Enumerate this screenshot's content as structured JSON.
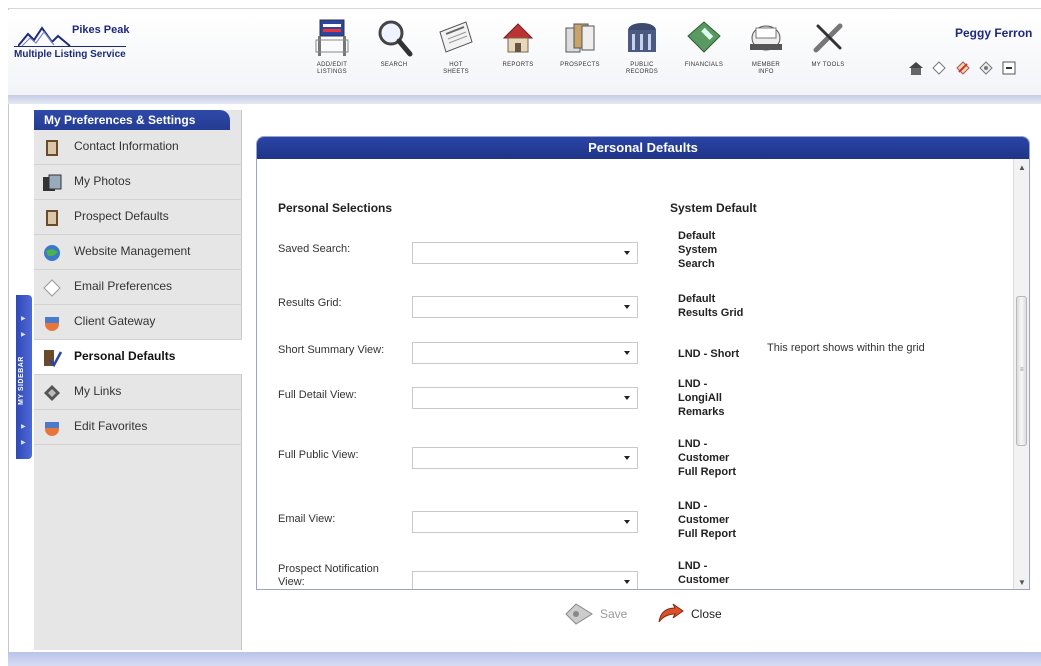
{
  "header": {
    "logo_line1": "Pikes Peak",
    "logo_line2": "Multiple Listing Service",
    "user_name": "Peggy Ferron",
    "tools": [
      {
        "label": "ADD/EDIT\nLISTINGS",
        "icon": "listing-sign-icon"
      },
      {
        "label": "SEARCH",
        "icon": "magnifier-icon"
      },
      {
        "label": "HOT\nSHEETS",
        "icon": "newspaper-icon"
      },
      {
        "label": "REPORTS",
        "icon": "house-report-icon"
      },
      {
        "label": "PROSPECTS",
        "icon": "files-icon"
      },
      {
        "label": "PUBLIC\nRECORDS",
        "icon": "building-icon"
      },
      {
        "label": "FINANCIALS",
        "icon": "calculator-icon"
      },
      {
        "label": "MEMBER\nINFO",
        "icon": "rolodex-icon"
      },
      {
        "label": "MY TOOLS",
        "icon": "wrench-icon"
      }
    ],
    "mini_icons": [
      "home-icon",
      "tag-icon",
      "tag-edit-icon",
      "tag-alt-icon",
      "minimize-icon"
    ]
  },
  "sidebar_strip": {
    "label": "MY SIDEBAR"
  },
  "left_nav": {
    "title": "My Preferences & Settings",
    "items": [
      {
        "label": "Contact Information",
        "icon": "address-book-icon",
        "active": false
      },
      {
        "label": "My Photos",
        "icon": "photos-icon",
        "active": false
      },
      {
        "label": "Prospect Defaults",
        "icon": "address-book-icon",
        "active": false
      },
      {
        "label": "Website Management",
        "icon": "globe-icon",
        "active": false
      },
      {
        "label": "Email Preferences",
        "icon": "envelope-icon",
        "active": false
      },
      {
        "label": "Client Gateway",
        "icon": "gateway-icon",
        "active": false
      },
      {
        "label": "Personal Defaults",
        "icon": "check-icon",
        "active": true
      },
      {
        "label": "My Links",
        "icon": "links-icon",
        "active": false
      },
      {
        "label": "Edit Favorites",
        "icon": "favorites-icon",
        "active": false
      }
    ]
  },
  "main": {
    "title": "Personal Defaults",
    "col_personal": "Personal Selections",
    "col_system": "System Default",
    "rows": [
      {
        "label": "Saved Search:",
        "value": "",
        "system_default": "Default\nSystem\nSearch",
        "note": ""
      },
      {
        "label": "Results Grid:",
        "value": "",
        "system_default": "Default\nResults Grid",
        "note": ""
      },
      {
        "label": "Short Summary View:",
        "value": "",
        "system_default": "LND - Short",
        "note": "This report shows within the grid"
      },
      {
        "label": "Full Detail View:",
        "value": "",
        "system_default": "LND -\nLongiAll\nRemarks",
        "note": ""
      },
      {
        "label": "Full Public View:",
        "value": "",
        "system_default": "LND -\nCustomer\nFull Report",
        "note": ""
      },
      {
        "label": "Email View:",
        "value": "",
        "system_default": "LND -\nCustomer\nFull Report",
        "note": ""
      },
      {
        "label": "Prospect Notification\nView:",
        "value": "",
        "system_default": "LND -\nCustomer\nFull Report",
        "note": ""
      }
    ]
  },
  "footer": {
    "save_label": "Save",
    "close_label": "Close"
  },
  "colors": {
    "accent": "#2a45a6",
    "panel_bg": "#e6e6e6"
  }
}
